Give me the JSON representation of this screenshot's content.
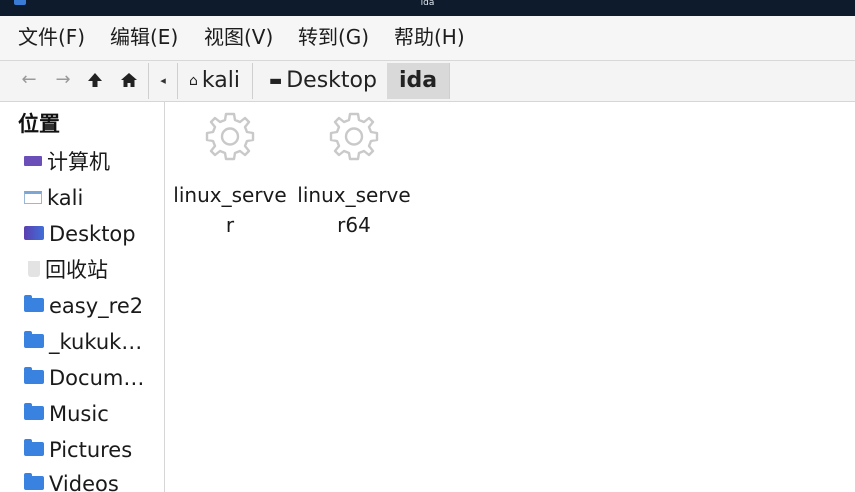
{
  "window": {
    "title": "ida"
  },
  "menubar": {
    "items": [
      {
        "label": "文件(F)"
      },
      {
        "label": "编辑(E)"
      },
      {
        "label": "视图(V)"
      },
      {
        "label": "转到(G)"
      },
      {
        "label": "帮助(H)"
      }
    ]
  },
  "toolbar": {
    "back_icon": "←",
    "forward_icon": "→",
    "up_icon": "🡅",
    "home_icon": "⌂",
    "crumb_arrow": "◂"
  },
  "breadcrumb": {
    "items": [
      {
        "label": "kali",
        "icon": "home-icon"
      },
      {
        "label": "Desktop",
        "icon": "desktop-icon"
      },
      {
        "label": "ida",
        "active": true
      }
    ]
  },
  "sidebar": {
    "heading": "位置",
    "items": [
      {
        "label": "计算机",
        "icon": "drive-icon"
      },
      {
        "label": "kali",
        "icon": "home-folder-icon"
      },
      {
        "label": "Desktop",
        "icon": "desktop-icon"
      },
      {
        "label": "回收站",
        "icon": "trash-icon"
      },
      {
        "label": "easy_re2",
        "icon": "folder-icon"
      },
      {
        "label": "_kukuk…",
        "icon": "folder-icon"
      },
      {
        "label": "Docum…",
        "icon": "folder-icon"
      },
      {
        "label": "Music",
        "icon": "folder-icon"
      },
      {
        "label": "Pictures",
        "icon": "folder-icon"
      },
      {
        "label": "Videos",
        "icon": "folder-icon"
      }
    ]
  },
  "files": [
    {
      "name": "linux_server",
      "icon": "gear-icon"
    },
    {
      "name": "linux_server64",
      "icon": "gear-icon"
    }
  ],
  "colors": {
    "titlebar": "#0e1b2c",
    "folder": "#3a82e0",
    "active_crumb": "#d9d9d9"
  }
}
